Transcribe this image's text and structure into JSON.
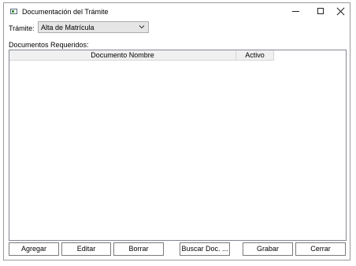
{
  "window": {
    "title": "Documentación del Trámite",
    "controls": {
      "minimize": "minimize-icon",
      "maximize": "maximize-icon",
      "close": "close-icon"
    }
  },
  "form": {
    "tramite_label": "Trámite:",
    "tramite_value": "Alta de Matrícula",
    "docs_label": "Documentos Requeridos:"
  },
  "grid": {
    "columns": [
      "Documento Nombre",
      "Activo"
    ],
    "rows": []
  },
  "buttons": {
    "agregar": "Agregar",
    "editar": "Editar",
    "borrar": "Borrar",
    "buscar": "Buscar Doc. ...",
    "grabar": "Grabar",
    "cerrar": "Cerrar"
  },
  "colors": {
    "combo_bg": "#e5e5e5",
    "header_bg": "#f0f0f0",
    "border": "#7a7a7a"
  }
}
